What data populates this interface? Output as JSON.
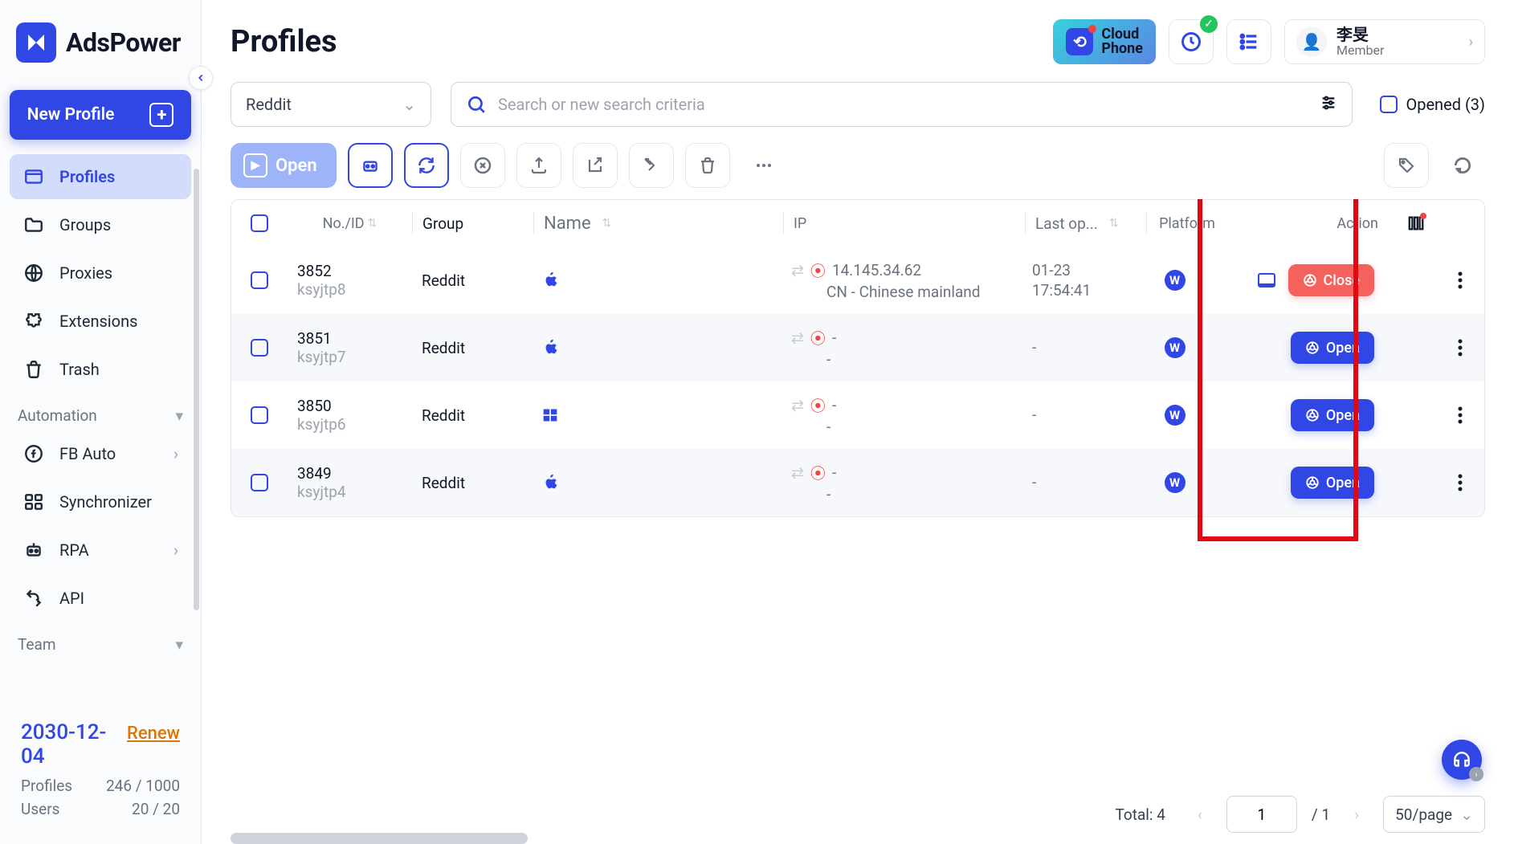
{
  "brand": "AdsPower",
  "sidebar": {
    "new_profile": "New Profile",
    "items": [
      {
        "label": "Profiles",
        "icon": "browser"
      },
      {
        "label": "Groups",
        "icon": "folder"
      },
      {
        "label": "Proxies",
        "icon": "globe"
      },
      {
        "label": "Extensions",
        "icon": "puzzle"
      },
      {
        "label": "Trash",
        "icon": "trash"
      }
    ],
    "automation_label": "Automation",
    "automation_items": [
      {
        "label": "FB Auto",
        "icon": "facebook",
        "chevron": true
      },
      {
        "label": "Synchronizer",
        "icon": "sync"
      },
      {
        "label": "RPA",
        "icon": "robot",
        "chevron": true
      },
      {
        "label": "API",
        "icon": "api"
      }
    ],
    "team_label": "Team",
    "footer": {
      "date": "2030-12-04",
      "renew": "Renew",
      "profiles_label": "Profiles",
      "profiles_value": "246 / 1000",
      "users_label": "Users",
      "users_value": "20 / 20"
    }
  },
  "header": {
    "title": "Profiles",
    "cloud_phone": "Cloud\nPhone",
    "user_name": "李旻",
    "user_role": "Member"
  },
  "filter": {
    "group_selected": "Reddit",
    "search_placeholder": "Search or new search criteria",
    "opened_label": "Opened (3)"
  },
  "action_bar": {
    "open_label": "Open"
  },
  "table": {
    "headers": {
      "no": "No./ID",
      "group": "Group",
      "name": "Name",
      "ip": "IP",
      "last_op": "Last op...",
      "platform": "Platform",
      "action": "Action"
    },
    "rows": [
      {
        "no": "3852",
        "serial": "ksyjtp8",
        "group": "Reddit",
        "os": "apple",
        "ip": "14.145.34.62",
        "ip_loc": "CN - Chinese mainland",
        "last_date": "01-23",
        "last_time": "17:54:41",
        "plat": "W",
        "plat_extra": "-",
        "action": "Close",
        "action_type": "red",
        "show_monitor": true
      },
      {
        "no": "3851",
        "serial": "ksyjtp7",
        "group": "Reddit",
        "os": "apple",
        "ip": "-",
        "ip_loc": "-",
        "last_date": "-",
        "last_time": "",
        "plat": "W",
        "plat_extra": "-",
        "action": "Open",
        "action_type": "blue",
        "show_monitor": false
      },
      {
        "no": "3850",
        "serial": "ksyjtp6",
        "group": "Reddit",
        "os": "windows",
        "ip": "-",
        "ip_loc": "-",
        "last_date": "-",
        "last_time": "",
        "plat": "W",
        "plat_extra": "-",
        "action": "Open",
        "action_type": "blue",
        "show_monitor": false
      },
      {
        "no": "3849",
        "serial": "ksyjtp4",
        "group": "Reddit",
        "os": "apple",
        "ip": "-",
        "ip_loc": "-",
        "last_date": "-",
        "last_time": "",
        "plat": "W",
        "plat_extra": "-",
        "action": "Open",
        "action_type": "blue",
        "show_monitor": false
      }
    ]
  },
  "pagination": {
    "total_label": "Total: 4",
    "current": "1",
    "total_pages": "/ 1",
    "size_label": "50/page"
  }
}
